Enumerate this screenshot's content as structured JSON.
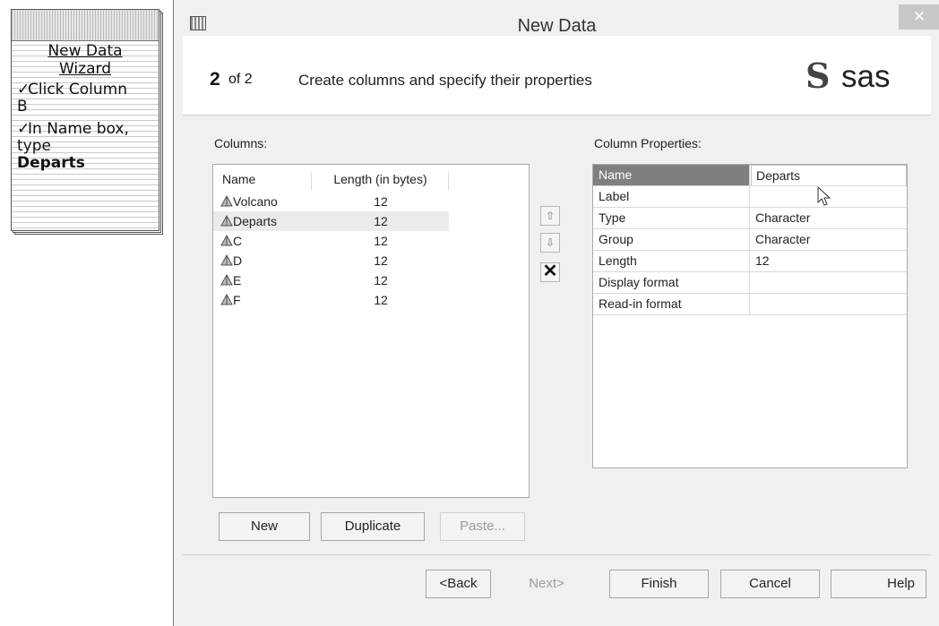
{
  "notepad": {
    "title_line1": "New Data",
    "title_line2": "Wizard",
    "check": "✓",
    "item1_line1": "Click Column",
    "item1_line2": "B",
    "item2_line1": "In Name box,",
    "item2_line2": "type",
    "item2_value": "Departs"
  },
  "dialog": {
    "title": "New Data",
    "close_glyph": "✕",
    "step_number": "2",
    "step_of": "of 2",
    "step_description": "Create columns and specify their properties",
    "logo_text": "sas",
    "logo_mark": "S"
  },
  "columns": {
    "label": "Columns:",
    "headers": [
      "Name",
      "Length (in bytes)"
    ],
    "rows": [
      {
        "name": "Volcano",
        "length": "12"
      },
      {
        "name": "Departs",
        "length": "12"
      },
      {
        "name": "C",
        "length": "12"
      },
      {
        "name": "D",
        "length": "12"
      },
      {
        "name": "E",
        "length": "12"
      },
      {
        "name": "F",
        "length": "12"
      }
    ],
    "selected_index": 1
  },
  "reorder": {
    "up_glyph": "⇧",
    "down_glyph": "⇩",
    "delete_glyph": "✕"
  },
  "properties": {
    "label": "Column Properties:",
    "rows": [
      {
        "key": "Name",
        "value": "Departs"
      },
      {
        "key": "Label",
        "value": ""
      },
      {
        "key": "Type",
        "value": "Character"
      },
      {
        "key": "Group",
        "value": "Character"
      },
      {
        "key": "Length",
        "value": "12"
      },
      {
        "key": "Display format",
        "value": ""
      },
      {
        "key": "Read-in format",
        "value": ""
      }
    ]
  },
  "list_buttons": {
    "new": "New",
    "duplicate": "Duplicate",
    "paste": "Paste..."
  },
  "nav_buttons": {
    "back": "<Back",
    "next": "Next>",
    "finish": "Finish",
    "cancel": "Cancel",
    "help": "Help"
  },
  "colors": {
    "dialog_bg": "#f0f0f0",
    "selected_row": "#ebebeb",
    "highlight_key": "#7f7f7f"
  }
}
